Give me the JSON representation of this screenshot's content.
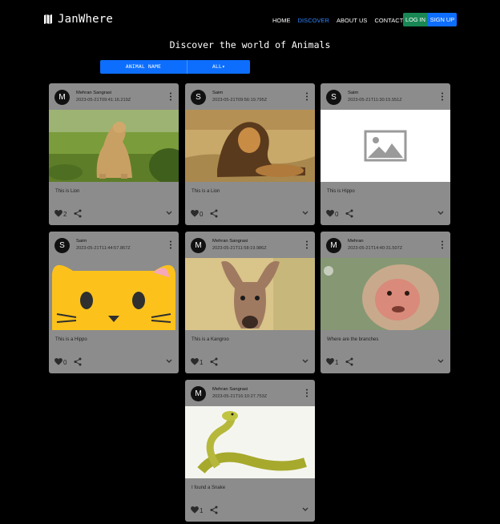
{
  "brand": {
    "name": "JanWhere"
  },
  "nav": {
    "links": [
      "HOME",
      "DISCOVER",
      "ABOUT US",
      "CONTACT US"
    ],
    "active": "DISCOVER",
    "login": "LOG IN",
    "signup": "SIGN UP"
  },
  "heading": "Discover the world of Animals",
  "filter": {
    "label": "ANIMAL NAME",
    "selected": "ALL▾"
  },
  "cards": [
    {
      "avatar": "M",
      "author": "Mehran Sangrasi",
      "date": "2023-05-21T09:41:16.219Z",
      "caption": "This is Lion",
      "likes": "2",
      "image": "lioness"
    },
    {
      "avatar": "S",
      "author": "Saim",
      "date": "2023-05-21T09:56:19.795Z",
      "caption": "This is a Lion",
      "likes": "0",
      "image": "lion"
    },
    {
      "avatar": "S",
      "author": "Saim",
      "date": "2023-05-21T11:30:15.551Z",
      "caption": "This is Hippo",
      "likes": "0",
      "image": "placeholder"
    },
    {
      "avatar": "S",
      "author": "Saim",
      "date": "2023-05-21T11:44:57.867Z",
      "caption": "This is a Hippo",
      "likes": "0",
      "image": "cat-emoji"
    },
    {
      "avatar": "M",
      "author": "Mehran Sangrasi",
      "date": "2023-05-21T11:58:19.986Z",
      "caption": "This is a Kangroo",
      "likes": "1",
      "image": "kangaroo"
    },
    {
      "avatar": "M",
      "author": "Mehran",
      "date": "2023-05-21T14:40:31.507Z",
      "caption": "Where are the branches",
      "likes": "1",
      "image": "monkey"
    },
    {
      "avatar": "M",
      "author": "Mehran Sangrasi",
      "date": "2023-05-21T16:10:27.753Z",
      "caption": "I found a Snake",
      "likes": "1",
      "image": "snake"
    }
  ],
  "icons": {
    "brand": "map-icon",
    "menu": "more-vert-icon",
    "like": "heart-icon",
    "share": "share-icon",
    "expand": "chevron-down-icon"
  },
  "colors": {
    "background": "#000000",
    "card": "#8c8c8c",
    "primary": "#0d6efd",
    "success": "#198754",
    "active_link": "#2f88ff"
  }
}
